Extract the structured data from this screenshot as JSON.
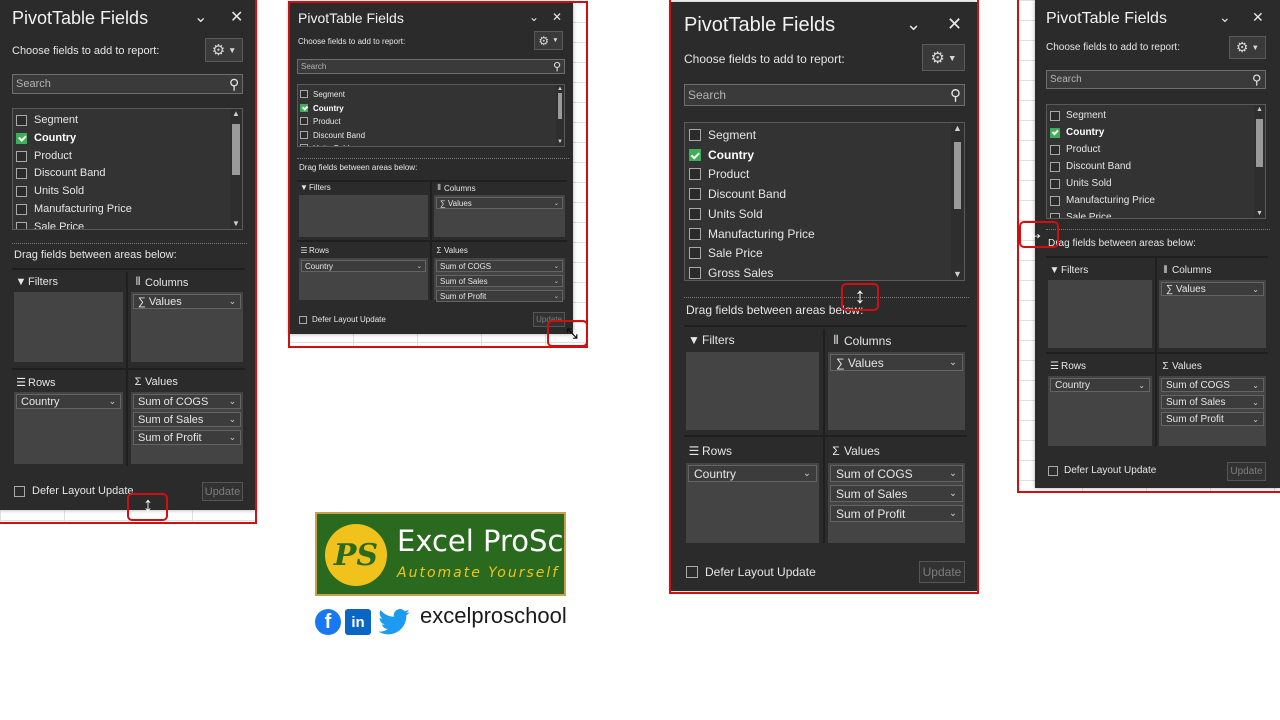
{
  "panel": {
    "title": "PivotTable Fields",
    "collapse_icon": "chevron-down-icon",
    "close_icon": "close-icon",
    "choose_label": "Choose fields to add to report:",
    "settings_icon": "gear-icon",
    "search_placeholder": "Search",
    "drag_label": "Drag fields between areas below:",
    "areas": {
      "filters": "Filters",
      "columns": "Columns",
      "rows": "Rows",
      "values": "Values"
    },
    "columns_items": [
      "∑ Values"
    ],
    "rows_items": [
      "Country"
    ],
    "values_items": [
      "Sum of COGS",
      "Sum of  Sales",
      "Sum of Profit"
    ],
    "defer_label": "Defer Layout Update",
    "update_label": "Update"
  },
  "fields": [
    {
      "name": "Segment",
      "checked": false
    },
    {
      "name": "Country",
      "checked": true
    },
    {
      "name": "Product",
      "checked": false
    },
    {
      "name": "Discount Band",
      "checked": false
    },
    {
      "name": "Units Sold",
      "checked": false
    },
    {
      "name": "Manufacturing Price",
      "checked": false
    },
    {
      "name": "Sale Price",
      "checked": false
    },
    {
      "name": "Gross Sales",
      "checked": false
    }
  ],
  "cursors": {
    "vertical_resize": "↕",
    "horizontal_resize": "↔",
    "diagonal_resize": "⤡"
  },
  "brand": {
    "logo_initials": "PS",
    "logo_name": "Excel ProSchool",
    "logo_tagline": "Automate Yourself",
    "social_icons": [
      "facebook-icon",
      "linkedin-icon",
      "twitter-icon"
    ],
    "handle": "excelproschool"
  },
  "colors": {
    "panel_bg": "#2b2b2b",
    "highlight_border": "#d01010",
    "checkbox_checked": "#3fae5a",
    "logo_green": "#2a6a1e",
    "logo_gold": "#f1c21b"
  }
}
